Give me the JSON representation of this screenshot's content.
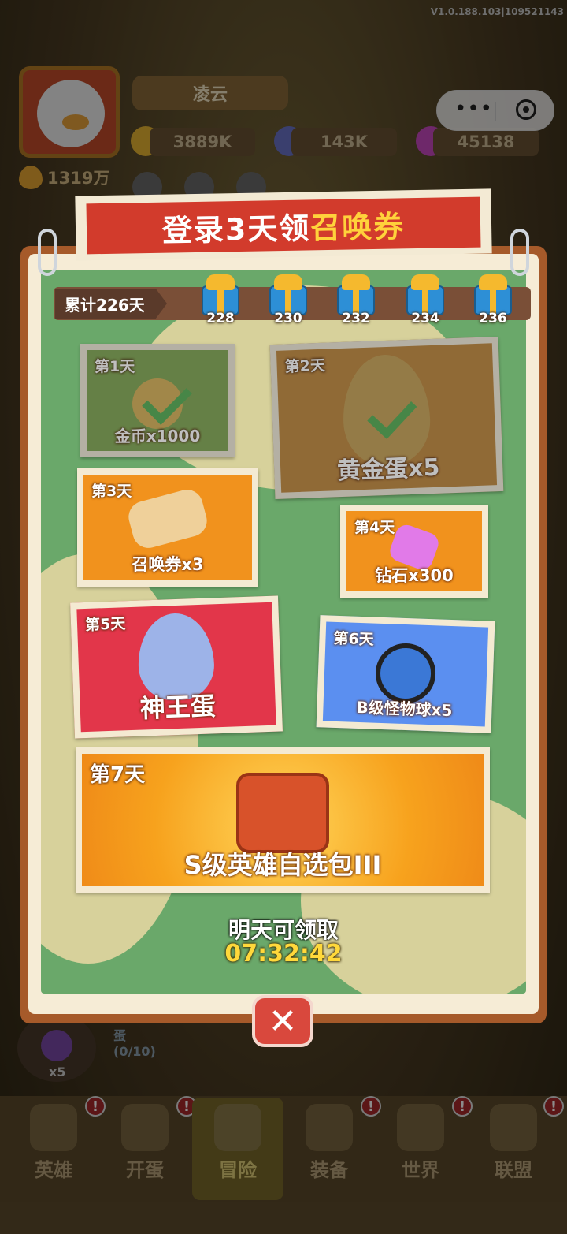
{
  "version": "V1.0.188.103|109521143",
  "player": {
    "name": "凌云",
    "gold": "3889K",
    "gems": "143K",
    "crystals": "45138",
    "power": "1319万"
  },
  "modal": {
    "title_prefix": "登录3天领",
    "title_highlight": "召唤券",
    "accumulated": "累计226天",
    "milestones": [
      "228",
      "230",
      "232",
      "234",
      "236"
    ],
    "days": [
      {
        "day": "第1天",
        "reward": "金币x1000",
        "claimed": true
      },
      {
        "day": "第2天",
        "reward": "黄金蛋x5",
        "claimed": true
      },
      {
        "day": "第3天",
        "reward": "召唤券x3",
        "claimed": false
      },
      {
        "day": "第4天",
        "reward": "钻石x300",
        "claimed": false
      },
      {
        "day": "第5天",
        "reward": "神王蛋",
        "claimed": false
      },
      {
        "day": "第6天",
        "reward": "B级怪物球x5",
        "claimed": false
      },
      {
        "day": "第7天",
        "reward": "S级英雄自选包III",
        "claimed": false
      }
    ],
    "next_claim_label": "明天可领取",
    "countdown": "07:32:42"
  },
  "behind": {
    "egg_count": "x5",
    "egg_name": "蛋",
    "egg_progress": "(0/10)"
  },
  "nav": {
    "items": [
      {
        "label": "英雄",
        "badge": "!"
      },
      {
        "label": "开蛋",
        "badge": "!"
      },
      {
        "label": "冒险",
        "badge": ""
      },
      {
        "label": "装备",
        "badge": "!"
      },
      {
        "label": "世界",
        "badge": "!"
      },
      {
        "label": "联盟",
        "badge": "!"
      }
    ]
  },
  "colors": {
    "banner_red": "#d23b2c",
    "highlight_yellow": "#ffd23b",
    "timer_yellow": "#ffd83b",
    "check_green": "#3fbf3f"
  },
  "icons": [
    "more-icon",
    "close-mini-program-icon",
    "gift-icon",
    "check-icon",
    "close-icon",
    "flame-icon",
    "gold-coin-icon",
    "gem-icon",
    "crystal-icon"
  ]
}
